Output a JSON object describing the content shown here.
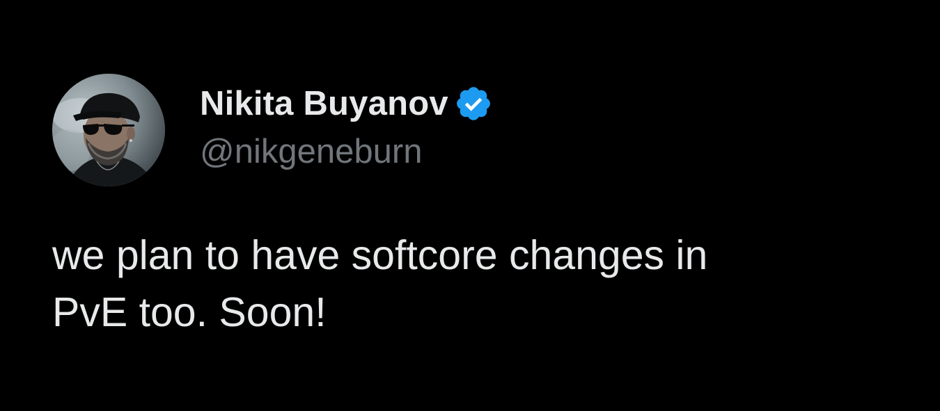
{
  "author": {
    "display_name": "Nikita Buyanov",
    "handle": "@nikgeneburn",
    "verified_icon": "verified-badge-icon",
    "avatar": "profile-photo"
  },
  "tweet": {
    "text": "we plan to have softcore changes in\nPvE too. Soon!"
  },
  "colors": {
    "background": "#000000",
    "primary_text": "#e7e9ea",
    "secondary_text": "#71767b",
    "verified_blue": "#1d9bf0"
  }
}
